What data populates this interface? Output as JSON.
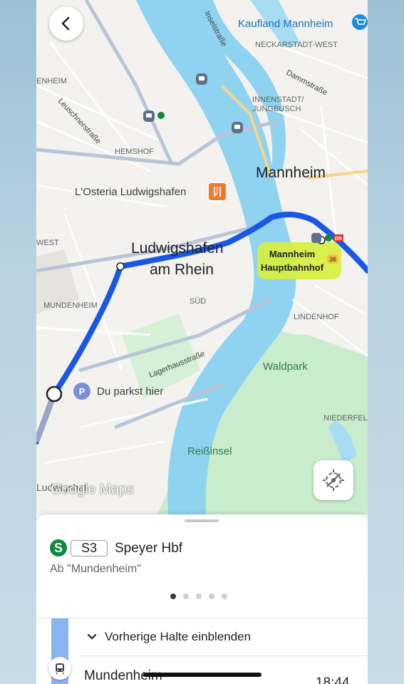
{
  "map": {
    "area_labels": {
      "mannheim": "Mannheim",
      "ludwigshafen_line1": "Ludwigshafen",
      "ludwigshafen_line2": "am Rhein",
      "hemshof": "HEMSHOF",
      "neckarstadt_west": "NECKARSTADT-WEST",
      "innenstadt_line1": "INNENSTADT/",
      "innenstadt_line2": "JUNGBUSCH",
      "sued": "SÜD",
      "lindenhof": "LINDENHOF",
      "niederfeld": "NIEDERFEL",
      "mundenheim": "MUNDENHEIM",
      "west": "WEST",
      "enheim": "ENHEIM",
      "waldpark": "Waldpark",
      "reissinsel": "Reißinsel"
    },
    "street_labels": {
      "inselstrasse": "Inselstraße",
      "dammstrasse": "Dammstraße",
      "leuschnerstrasse": "Leuschnerstraße",
      "lagerhausstrasse": "Lagerhausstraße"
    },
    "poi": {
      "kaufland": "Kaufland Mannheim",
      "osteria": "L'Osteria Ludwigshafen",
      "parking": "Du parkst hier",
      "station_line1": "Mannheim",
      "station_line2": "Hauptbahnhof",
      "db": "DB",
      "platform_number": "36",
      "partial_label": "Ludwigshaf"
    },
    "logo": "Google Maps",
    "colors": {
      "route": "#1a57e6",
      "water": "#8fd3f0",
      "park": "#c9eccd",
      "highlight": "#d7ef3a"
    }
  },
  "sheet": {
    "line_symbol": "S",
    "line_badge": "S3",
    "destination": "Speyer Hbf",
    "from_stop": "Ab \"Mundenheim\"",
    "page_count": 5,
    "active_page": 1
  },
  "stops": {
    "toggle_label": "Vorherige Halte einblenden",
    "first_stop_name": "Mundenheim",
    "first_stop_time": "18:44"
  }
}
